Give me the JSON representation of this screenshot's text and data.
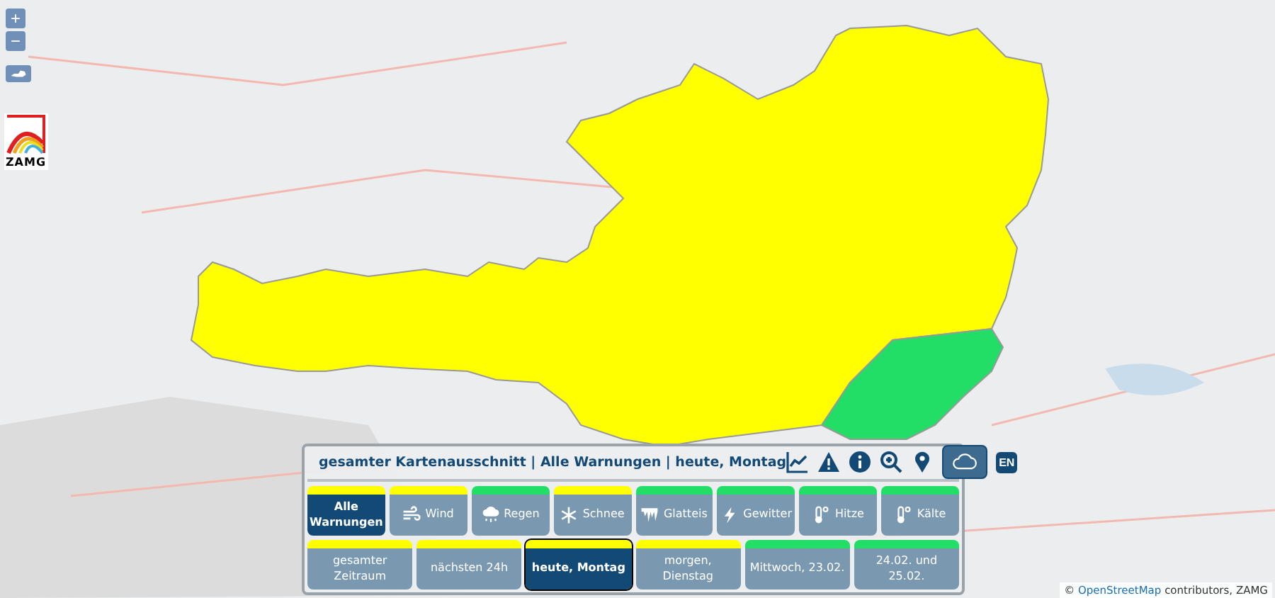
{
  "map_controls": [
    {
      "kind": "zoom-in",
      "label": "+"
    },
    {
      "kind": "zoom-out",
      "label": "−"
    },
    {
      "kind": "country"
    }
  ],
  "logo": {
    "text": "ZAMG"
  },
  "panel": {
    "title": "gesamter Kartenausschnitt | Alle Warnungen | heute, Montag",
    "tools": [
      {
        "kind": "chart",
        "selected": false
      },
      {
        "kind": "warning",
        "selected": false
      },
      {
        "kind": "info",
        "selected": false
      },
      {
        "kind": "zoom",
        "selected": false
      },
      {
        "kind": "pin",
        "selected": false
      },
      {
        "kind": "cloud",
        "selected": true
      }
    ],
    "language": "EN",
    "categories": [
      {
        "label": "Alle Warnungen",
        "kind": "all",
        "color": "#ffff00",
        "selected": true
      },
      {
        "label": "Wind",
        "kind": "wind",
        "color": "#ffff00",
        "selected": false
      },
      {
        "label": "Regen",
        "kind": "rain",
        "color": "#22dd66",
        "selected": false
      },
      {
        "label": "Schnee",
        "kind": "snow",
        "color": "#ffff00",
        "selected": false
      },
      {
        "label": "Glatteis",
        "kind": "ice",
        "color": "#22dd66",
        "selected": false
      },
      {
        "label": "Gewitter",
        "kind": "thunderstorm",
        "color": "#22dd66",
        "selected": false
      },
      {
        "label": "Hitze",
        "kind": "heat",
        "color": "#22dd66",
        "selected": false
      },
      {
        "label": "Kälte",
        "kind": "cold",
        "color": "#22dd66",
        "selected": false
      }
    ],
    "periods": [
      {
        "label": "gesamter Zeitraum",
        "color": "#ffff00",
        "selected": false
      },
      {
        "label": "nächsten 24h",
        "color": "#ffff00",
        "selected": false
      },
      {
        "label": "heute, Montag",
        "color": "#ffff00",
        "selected": true
      },
      {
        "label": "morgen, Dienstag",
        "color": "#ffff00",
        "selected": false
      },
      {
        "label": "Mittwoch, 23.02.",
        "color": "#22dd66",
        "selected": false
      },
      {
        "label": "24.02. und 25.02.",
        "color": "#22dd66",
        "selected": false
      }
    ]
  },
  "attribution": {
    "prefix": "©",
    "link": "OpenStreetMap",
    "suffix": "contributors, ZAMG"
  }
}
